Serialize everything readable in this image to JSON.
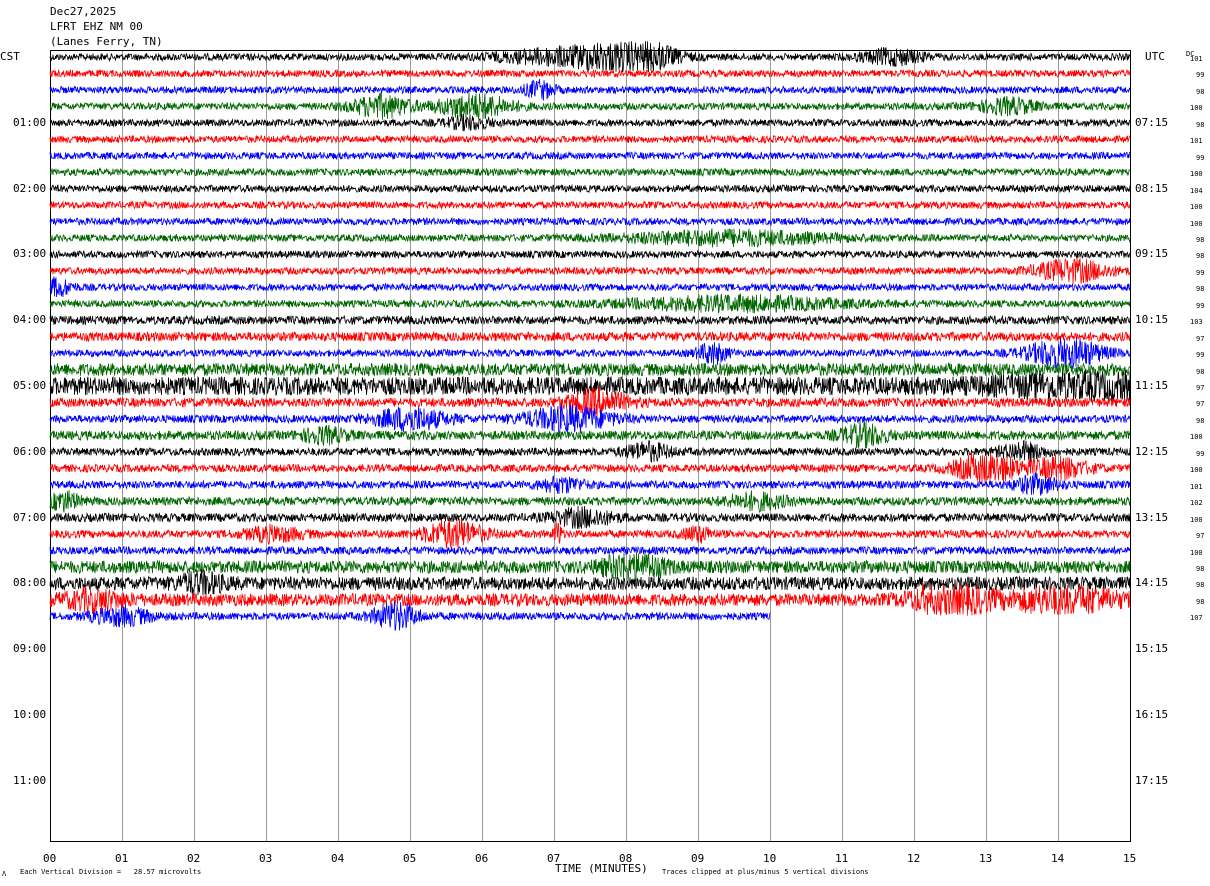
{
  "header": {
    "date": "Dec27,2025",
    "station": "LFRT EHZ NM 00",
    "location": "(Lanes Ferry, TN)"
  },
  "left_tz": "CST",
  "right_tz": "UTC",
  "dc_label": "DC",
  "footer": {
    "left_note": "Each Vertical Division =   28.57 microvolts",
    "x_title": "TIME (MINUTES)",
    "right_note": "Traces clipped at plus/minus 5 vertical divisions",
    "corner_mark": "Λ"
  },
  "colors": {
    "black": "#000000",
    "red": "#ff0000",
    "blue": "#0000ff",
    "green": "#006600",
    "grid": "#999999"
  },
  "chart_data": {
    "type": "line",
    "title": "",
    "xlabel": "TIME (MINUTES)",
    "xlim": [
      0,
      15
    ],
    "x_ticks": [
      "00",
      "01",
      "02",
      "03",
      "04",
      "05",
      "06",
      "07",
      "08",
      "09",
      "10",
      "11",
      "12",
      "13",
      "14",
      "15"
    ],
    "left_hour_labels": [
      "01:00",
      "02:00",
      "03:00",
      "04:00",
      "05:00",
      "06:00",
      "07:00",
      "08:00",
      "09:00",
      "10:00",
      "11:00"
    ],
    "right_hour_labels": [
      "07:15",
      "08:15",
      "09:15",
      "10:15",
      "11:15",
      "12:15",
      "13:15",
      "14:15",
      "15:15",
      "16:15",
      "17:15"
    ],
    "trace_color_cycle": [
      "black",
      "red",
      "blue",
      "green"
    ],
    "dc_offsets": [
      101,
      99,
      98,
      100,
      98,
      101,
      99,
      100,
      104,
      100,
      100,
      98,
      98,
      99,
      98,
      99,
      103,
      97,
      99,
      98,
      97,
      97,
      98,
      100,
      99,
      100,
      101,
      102,
      100,
      97,
      100,
      98,
      98,
      98,
      107
    ],
    "noise_levels": [
      1,
      1,
      1,
      1,
      1,
      1,
      1,
      1,
      1,
      1,
      1,
      1,
      1,
      1,
      1,
      1,
      1.2,
      1.3,
      1,
      1.8,
      2.6,
      1.3,
      1.1,
      1.3,
      1.1,
      1.1,
      1.1,
      1.2,
      1.2,
      1.1,
      1.1,
      1.8,
      1.9,
      1.8,
      1.1
    ],
    "events": [
      {
        "trace": 0,
        "minute": 8.1,
        "amp": 6,
        "dur": 0.5
      },
      {
        "trace": 0,
        "minute": 7.2,
        "amp": 2.5,
        "dur": 0.9
      },
      {
        "trace": 0,
        "minute": 11.7,
        "amp": 2.2,
        "dur": 0.4
      },
      {
        "trace": 2,
        "minute": 6.8,
        "amp": 2.5,
        "dur": 0.2
      },
      {
        "trace": 3,
        "minute": 4.6,
        "amp": 3.2,
        "dur": 0.4
      },
      {
        "trace": 3,
        "minute": 5.9,
        "amp": 3.5,
        "dur": 0.5
      },
      {
        "trace": 3,
        "minute": 13.3,
        "amp": 2.2,
        "dur": 0.4
      },
      {
        "trace": 4,
        "minute": 5.8,
        "amp": 1.8,
        "dur": 0.3
      },
      {
        "trace": 11,
        "minute": 9.4,
        "amp": 2,
        "dur": 1.4
      },
      {
        "trace": 13,
        "minute": 14.2,
        "amp": 3.2,
        "dur": 0.5
      },
      {
        "trace": 14,
        "minute": 0.1,
        "amp": 2.5,
        "dur": 0.2
      },
      {
        "trace": 15,
        "minute": 9.5,
        "amp": 2,
        "dur": 1.5
      },
      {
        "trace": 18,
        "minute": 14.1,
        "amp": 4.5,
        "dur": 0.5
      },
      {
        "trace": 18,
        "minute": 9.2,
        "amp": 3,
        "dur": 0.2
      },
      {
        "trace": 20,
        "minute": 14.4,
        "amp": 2.5,
        "dur": 1.2
      },
      {
        "trace": 21,
        "minute": 7.6,
        "amp": 3.5,
        "dur": 0.4
      },
      {
        "trace": 22,
        "minute": 5,
        "amp": 3.2,
        "dur": 0.5
      },
      {
        "trace": 22,
        "minute": 7.2,
        "amp": 3.5,
        "dur": 0.6
      },
      {
        "trace": 23,
        "minute": 11.3,
        "amp": 3,
        "dur": 0.3
      },
      {
        "trace": 23,
        "minute": 3.8,
        "amp": 2,
        "dur": 0.3
      },
      {
        "trace": 24,
        "minute": 8.3,
        "amp": 2.5,
        "dur": 0.3
      },
      {
        "trace": 24,
        "minute": 13.5,
        "amp": 2.5,
        "dur": 0.3
      },
      {
        "trace": 25,
        "minute": 13,
        "amp": 5,
        "dur": 0.4
      },
      {
        "trace": 25,
        "minute": 14,
        "amp": 3,
        "dur": 0.4
      },
      {
        "trace": 26,
        "minute": 13.7,
        "amp": 2.5,
        "dur": 0.3
      },
      {
        "trace": 26,
        "minute": 7.1,
        "amp": 2,
        "dur": 0.3
      },
      {
        "trace": 27,
        "minute": 0.2,
        "amp": 2.5,
        "dur": 0.2
      },
      {
        "trace": 27,
        "minute": 9.8,
        "amp": 2.2,
        "dur": 0.4
      },
      {
        "trace": 28,
        "minute": 7.4,
        "amp": 2.5,
        "dur": 0.4
      },
      {
        "trace": 29,
        "minute": 5.6,
        "amp": 4,
        "dur": 0.4
      },
      {
        "trace": 29,
        "minute": 7.05,
        "amp": 4,
        "dur": 0.05
      },
      {
        "trace": 29,
        "minute": 3.1,
        "amp": 2,
        "dur": 0.4
      },
      {
        "trace": 29,
        "minute": 9,
        "amp": 2,
        "dur": 0.2
      },
      {
        "trace": 31,
        "minute": 8.1,
        "amp": 4,
        "dur": 0.4
      },
      {
        "trace": 32,
        "minute": 2.1,
        "amp": 2.5,
        "dur": 0.3
      },
      {
        "trace": 33,
        "minute": 12.5,
        "amp": 5,
        "dur": 0.5
      },
      {
        "trace": 33,
        "minute": 14.1,
        "amp": 4,
        "dur": 0.7
      },
      {
        "trace": 33,
        "minute": 0.6,
        "amp": 2.5,
        "dur": 0.4
      },
      {
        "trace": 34,
        "minute": 4.8,
        "amp": 4,
        "dur": 0.3
      },
      {
        "trace": 34,
        "minute": 1,
        "amp": 2.5,
        "dur": 0.4
      },
      {
        "trace": 35,
        "minute": 0.7,
        "amp": 4,
        "dur": 0.5
      },
      {
        "trace": 35,
        "minute": 9,
        "amp": 1.5,
        "dur": 0.4
      }
    ],
    "last_trace_end_minute": 10
  }
}
